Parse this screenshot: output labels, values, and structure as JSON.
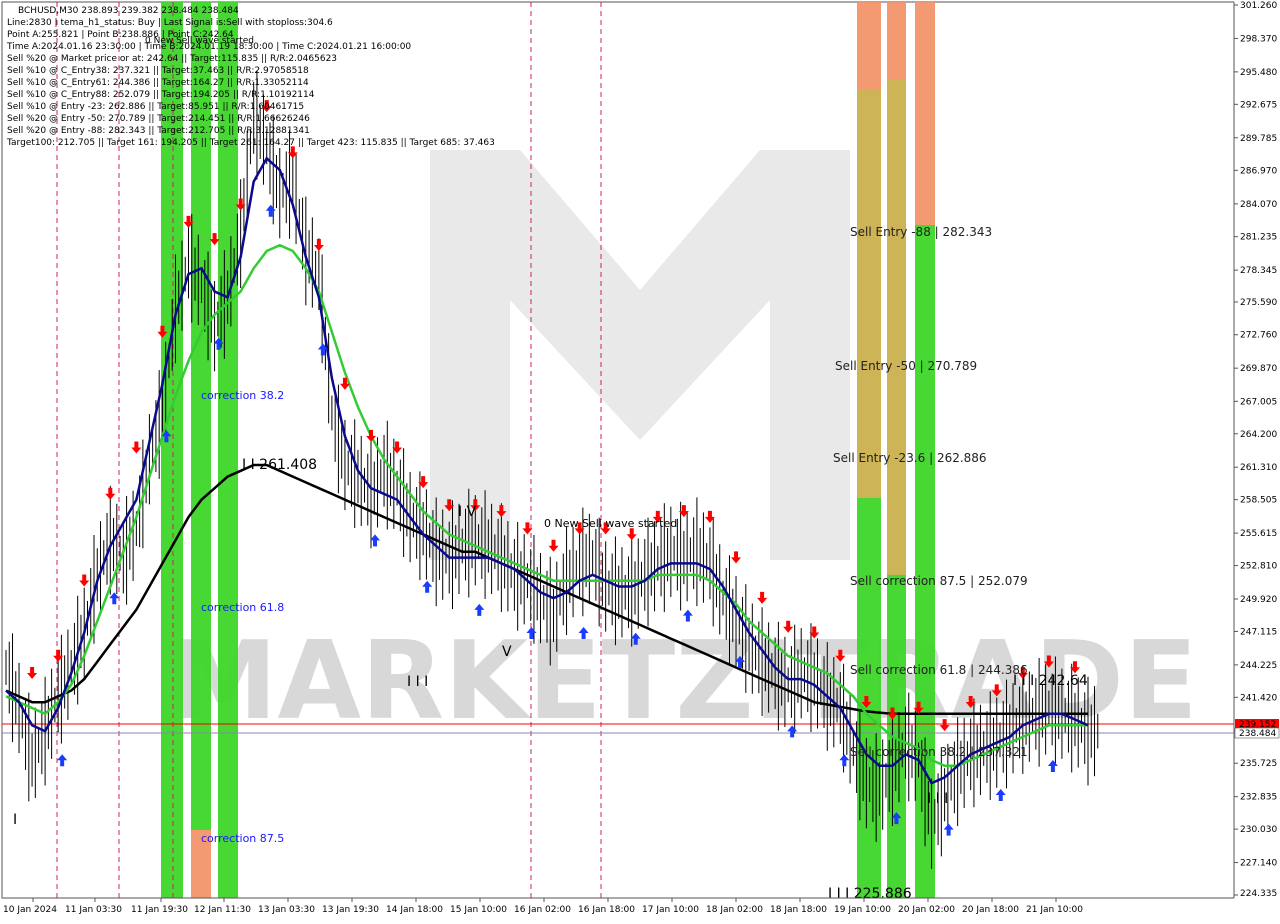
{
  "info": {
    "title": "BCHUSD,M30  238.893 239.382 238.484 238.484",
    "lines": [
      "Line:2830 | tema_h1_status: Buy | Last Signal is:Sell with stoploss:304.6",
      "Point A:255.821 | Point B:238.886 | Point C:242.64",
      "Time A:2024.01.16 23:30:00 | Time B:2024.01.19 18:30:00 | Time C:2024.01.21 16:00:00",
      "Sell %20 @ Market price or at: 242.64 || Target:115.835 || R/R:2.0465623",
      "Sell %10 @ C_Entry38: 237.321 || Target:37.463 || R/R:2.97058518",
      "Sell %10 @ C_Entry61: 244.386 || Target:164.27 || R/R:1.33052114",
      "Sell %10 @ C_Entry88: 252.079 || Target:194.205 || R/R:1.10192114",
      "Sell %10 @ Entry -23: 262.886 || Target:85.951 || R/R:1.60461715",
      "Sell %20 @ Entry -50: 270.789 || Target:214.451 || R/R:1.66626246",
      "Sell %20 @ Entry -88: 282.343 || Target:212.705 || R/R:3.12881341",
      "Target100: 212.705 || Target 161: 194.205 || Target 261: 164.27 || Target 423: 115.835 || Target 685: 37.463"
    ]
  },
  "watermark": "MARKETZITRADE",
  "labels": {
    "new_sell_top": "0 New Sell wave started",
    "new_sell_mid": "0 New Sell wave started",
    "sell_entry_88": "Sell Entry -88 | 282.343",
    "sell_entry_50": "Sell Entry -50 | 270.789",
    "sell_entry_23": "Sell Entry -23.6 | 262.886",
    "sell_corr_875": "Sell correction 87.5 | 252.079",
    "sell_corr_618": "Sell correction 61.8 | 244.386",
    "sell_corr_382": "Sell correction 38.2 | 237.321",
    "corr_382": "correction 38.2",
    "corr_618": "correction 61.8",
    "corr_875": "correction 87.5",
    "point_a": "I I 261.408",
    "point_c": "I I I 242.64",
    "point_b": "I I I 225.886",
    "wave_iv": "I V",
    "wave_v": "V",
    "wave_iii_a": "I I I",
    "wave_iii_b": "I I I",
    "wave_i": "I"
  },
  "price_labels": {
    "red_line": "239.152",
    "current": "238.484"
  },
  "colors": {
    "green_band": "#3dd629",
    "salmon_band": "#f2956b",
    "olive_band": "#c9b04e",
    "ma_blue": "#0a0a8c",
    "ma_green": "#33cc33",
    "ma_black": "#000000",
    "red_line": "#ff0000",
    "gray_line": "#8888aa",
    "sell_arrow": "#ff0000",
    "buy_arrow": "#1a3cff"
  },
  "chart_data": {
    "type": "line",
    "symbol": "BCHUSD",
    "timeframe": "M30",
    "ylim": [
      224.335,
      301.26
    ],
    "y_ticks": [
      "301.260",
      "298.370",
      "295.480",
      "292.675",
      "289.785",
      "286.970",
      "284.070",
      "281.235",
      "278.345",
      "275.590",
      "272.760",
      "269.870",
      "267.005",
      "264.200",
      "261.310",
      "258.505",
      "255.615",
      "252.810",
      "249.920",
      "247.115",
      "244.225",
      "241.420",
      "238.530",
      "235.725",
      "232.835",
      "230.030",
      "227.140",
      "224.335"
    ],
    "x_ticks": [
      "10 Jan 2024",
      "11 Jan 03:30",
      "11 Jan 19:30",
      "12 Jan 11:30",
      "13 Jan 03:30",
      "13 Jan 19:30",
      "14 Jan 18:00",
      "15 Jan 10:00",
      "16 Jan 02:00",
      "16 Jan 18:00",
      "17 Jan 10:00",
      "18 Jan 02:00",
      "18 Jan 18:00",
      "19 Jan 10:00",
      "20 Jan 02:00",
      "20 Jan 18:00",
      "21 Jan 10:00"
    ],
    "ohlc_last": {
      "open": 238.893,
      "high": 239.382,
      "low": 238.484,
      "close": 238.484
    },
    "levels": [
      {
        "name": "Sell Entry -88",
        "value": 282.343
      },
      {
        "name": "Sell Entry -50",
        "value": 270.789
      },
      {
        "name": "Sell Entry -23.6",
        "value": 262.886
      },
      {
        "name": "Sell correction 87.5",
        "value": 252.079
      },
      {
        "name": "Sell correction 61.8",
        "value": 244.386
      },
      {
        "name": "Sell correction 38.2",
        "value": 237.321
      }
    ],
    "points": {
      "A": 255.821,
      "B": 238.886,
      "C": 242.64
    },
    "series": [
      {
        "name": "close",
        "values": [
          244.0,
          240.5,
          236.0,
          238.5,
          241.5,
          244.0,
          247.0,
          252.0,
          255.0,
          253.5,
          256.0,
          262.0,
          266.0,
          275.0,
          279.0,
          277.0,
          273.5,
          276.0,
          281.5,
          291.5,
          289.0,
          285.0,
          286.0,
          280.0,
          278.0,
          266.0,
          261.5,
          260.5,
          259.0,
          261.0,
          259.5,
          257.0,
          256.0,
          254.0,
          253.5,
          254.5,
          255.0,
          254.5,
          253.5,
          252.0,
          251.5,
          250.0,
          248.5,
          251.5,
          253.0,
          253.5,
          251.0,
          250.5,
          250.5,
          252.0,
          253.0,
          254.0,
          253.5,
          254.0,
          253.0,
          250.0,
          248.0,
          246.0,
          244.5,
          243.5,
          242.5,
          243.5,
          243.0,
          241.5,
          240.5,
          237.0,
          234.0,
          233.5,
          235.0,
          237.5,
          236.0,
          230.5,
          233.0,
          235.0,
          236.5,
          237.0,
          237.5,
          238.5,
          239.5,
          240.0,
          240.5,
          240.0,
          239.5,
          238.5
        ]
      },
      {
        "name": "tema_fast",
        "values": [
          242.0,
          241.0,
          239.0,
          238.5,
          240.5,
          243.5,
          247.0,
          251.5,
          254.5,
          256.5,
          258.5,
          263.5,
          268.5,
          274.5,
          278.0,
          278.5,
          276.5,
          276.0,
          279.5,
          286.0,
          288.0,
          287.0,
          284.0,
          279.5,
          276.0,
          269.0,
          264.0,
          261.0,
          259.5,
          259.0,
          258.5,
          257.0,
          255.5,
          254.5,
          253.5,
          253.5,
          253.5,
          253.5,
          253.0,
          252.5,
          251.5,
          250.5,
          250.0,
          250.5,
          251.5,
          252.0,
          251.5,
          251.0,
          251.0,
          251.5,
          252.5,
          253.0,
          253.0,
          253.0,
          252.5,
          251.0,
          249.0,
          247.0,
          245.5,
          244.0,
          243.0,
          243.0,
          242.5,
          241.5,
          240.5,
          238.5,
          236.5,
          235.5,
          235.5,
          236.5,
          236.0,
          234.0,
          234.5,
          235.5,
          236.5,
          237.0,
          237.5,
          238.0,
          239.0,
          239.5,
          240.0,
          240.0,
          239.5,
          239.0
        ]
      },
      {
        "name": "ma_green",
        "values": [
          241.5,
          241.0,
          240.5,
          240.0,
          241.0,
          242.5,
          245.0,
          248.0,
          251.0,
          254.0,
          257.0,
          260.5,
          264.0,
          267.5,
          270.5,
          273.0,
          274.5,
          275.5,
          276.5,
          278.5,
          280.0,
          280.5,
          280.0,
          278.5,
          276.5,
          273.0,
          269.5,
          266.5,
          264.0,
          262.0,
          260.5,
          259.0,
          257.5,
          256.5,
          255.5,
          255.0,
          254.5,
          254.0,
          253.5,
          253.0,
          252.5,
          252.0,
          251.5,
          251.5,
          251.5,
          251.5,
          251.5,
          251.5,
          251.5,
          251.5,
          252.0,
          252.0,
          252.0,
          252.0,
          251.5,
          250.5,
          249.5,
          248.0,
          247.0,
          246.0,
          245.0,
          244.5,
          244.0,
          243.5,
          242.5,
          241.5,
          240.0,
          239.0,
          238.0,
          237.5,
          237.0,
          236.0,
          235.5,
          235.5,
          236.0,
          236.5,
          237.0,
          237.5,
          238.0,
          238.5,
          239.0,
          239.0,
          239.0,
          239.0
        ]
      },
      {
        "name": "ma_black",
        "values": [
          242.0,
          241.5,
          241.0,
          241.0,
          241.5,
          242.0,
          243.0,
          244.5,
          246.0,
          247.5,
          249.0,
          251.0,
          253.0,
          255.0,
          257.0,
          258.5,
          259.5,
          260.5,
          261.0,
          261.5,
          261.5,
          261.0,
          260.5,
          260.0,
          259.5,
          259.0,
          258.5,
          258.0,
          257.5,
          257.0,
          256.5,
          256.0,
          255.5,
          255.0,
          254.5,
          254.0,
          254.0,
          253.5,
          253.0,
          252.5,
          252.0,
          251.5,
          251.0,
          250.5,
          250.0,
          249.5,
          249.0,
          248.5,
          248.0,
          247.5,
          247.0,
          246.5,
          246.0,
          245.5,
          245.0,
          244.5,
          244.0,
          243.5,
          243.0,
          242.5,
          242.0,
          241.5,
          241.0,
          240.8,
          240.6,
          240.4,
          240.2,
          240.1,
          240.0,
          240.0,
          240.0,
          240.0,
          240.0,
          240.0,
          240.0,
          240.0,
          240.0,
          240.0,
          240.0,
          240.0,
          240.0,
          240.0,
          240.0,
          240.0
        ]
      }
    ],
    "grid": false,
    "legend": "none"
  }
}
